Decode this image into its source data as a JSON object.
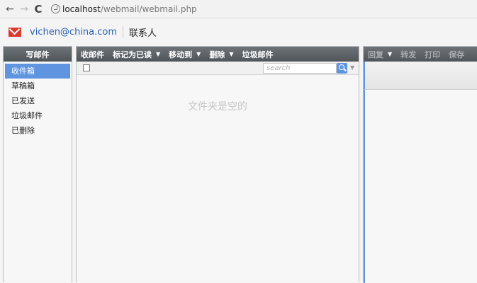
{
  "browser": {
    "url_host": "localhost",
    "url_path": "/webmail/webmail.php"
  },
  "header": {
    "user_email": "vichen@china.com",
    "contacts_label": "联系人"
  },
  "left_panel": {
    "compose_label": "写邮件",
    "folders": [
      {
        "label": "收件箱",
        "active": true
      },
      {
        "label": "草稿箱",
        "active": false
      },
      {
        "label": "已发送",
        "active": false
      },
      {
        "label": "垃圾邮件",
        "active": false
      },
      {
        "label": "已删除",
        "active": false
      }
    ]
  },
  "mid_panel": {
    "toolbar": {
      "receive_label": "收邮件",
      "mark_read_label": "标记为已读",
      "move_to_label": "移动到",
      "delete_label": "删除",
      "spam_label": "垃圾邮件"
    },
    "search_placeholder": "search",
    "empty_message": "文件夹是空的"
  },
  "right_panel": {
    "toolbar": {
      "reply_label": "回复",
      "forward_label": "转发",
      "print_label": "打印",
      "save_label": "保存"
    }
  }
}
